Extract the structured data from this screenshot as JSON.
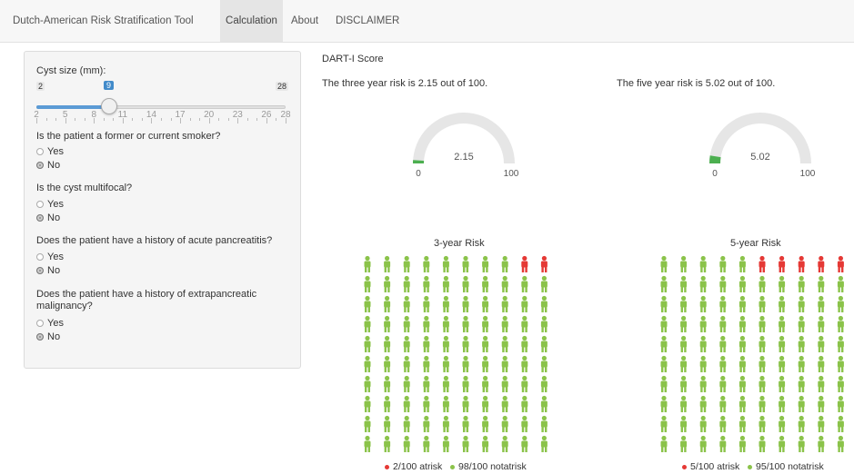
{
  "navbar": {
    "brand": "Dutch-American Risk Stratification Tool",
    "tabs": [
      {
        "label": "Calculation",
        "active": true
      },
      {
        "label": "About",
        "active": false
      },
      {
        "label": "DISCLAIMER",
        "active": false
      }
    ]
  },
  "sidebar": {
    "slider": {
      "label": "Cyst size (mm):",
      "min": 2,
      "max": 28,
      "value": 9,
      "min_label": "2",
      "max_label": "28",
      "value_label": "9",
      "ticks": [
        "2",
        "5",
        "8",
        "11",
        "14",
        "17",
        "20",
        "23",
        "26",
        "28"
      ]
    },
    "questions": [
      {
        "label": "Is the patient a former or current smoker?",
        "options": [
          "Yes",
          "No"
        ],
        "selected": "No"
      },
      {
        "label": "Is the cyst multifocal?",
        "options": [
          "Yes",
          "No"
        ],
        "selected": "No"
      },
      {
        "label": "Does the patient have a history of acute pancreatitis?",
        "options": [
          "Yes",
          "No"
        ],
        "selected": "No"
      },
      {
        "label_line1": "Does the patient have a history of extrapancreatic",
        "label_line2": "malignancy?",
        "options": [
          "Yes",
          "No"
        ],
        "selected": "No"
      }
    ]
  },
  "main": {
    "score_title": "DART-I Score",
    "three_year_text": "The three year risk is 2.15 out of 100.",
    "five_year_text": "The five year risk is 5.02 out of 100."
  },
  "colors": {
    "gauge_track": "#e6e6e6",
    "gauge_fill": "#4caf50",
    "person_safe": "#8bc34a",
    "person_risk": "#e53935"
  },
  "chart_data": [
    {
      "type": "gauge",
      "value": 2.15,
      "min": 0,
      "max": 100,
      "value_label": "2.15",
      "min_label": "0",
      "max_label": "100"
    },
    {
      "type": "gauge",
      "value": 5.02,
      "min": 0,
      "max": 100,
      "value_label": "5.02",
      "min_label": "0",
      "max_label": "100"
    },
    {
      "type": "pictogram",
      "title": "3-year Risk",
      "at_risk": 2,
      "not_at_risk": 98,
      "total": 100,
      "legend": [
        "2/100 atrisk",
        "98/100 notatrisk"
      ]
    },
    {
      "type": "pictogram",
      "title": "5-year Risk",
      "at_risk": 5,
      "not_at_risk": 95,
      "total": 100,
      "legend": [
        "5/100 atrisk",
        "95/100 notatrisk"
      ]
    }
  ]
}
